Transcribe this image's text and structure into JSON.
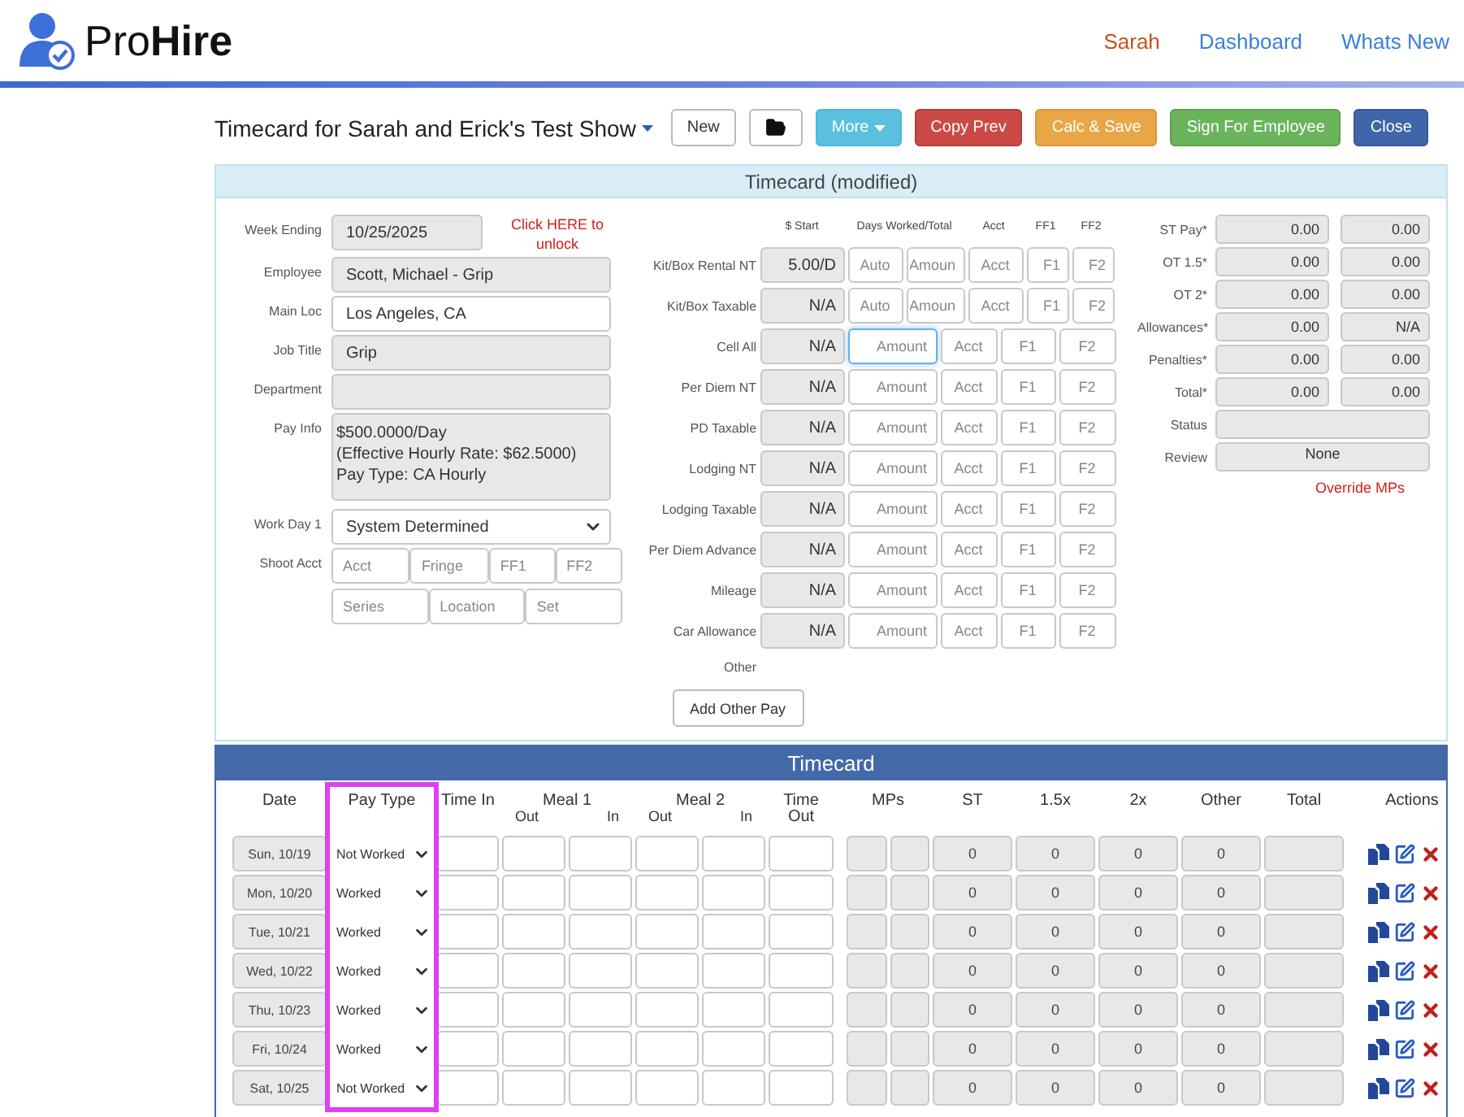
{
  "header": {
    "logo": "Pro**Hire**",
    "nav": [
      {
        "label": "Sarah",
        "kind": "user"
      },
      {
        "label": "Dashboard",
        "kind": "link"
      },
      {
        "label": "Whats New",
        "kind": "link"
      }
    ]
  },
  "toolbar": {
    "title": "Timecard for Sarah and Erick's Test Show",
    "buttons": [
      {
        "label": "New",
        "kind": "default",
        "dropdown": false
      },
      {
        "kind": "folder",
        "dropdown": false
      },
      {
        "label": "More",
        "kind": "info",
        "dropdown": true
      },
      {
        "label": "Copy Prev",
        "kind": "danger",
        "dropdown": false
      },
      {
        "label": "Calc & Save",
        "kind": "warning",
        "dropdown": false
      },
      {
        "label": "Sign For Employee",
        "kind": "success",
        "dropdown": false
      },
      {
        "label": "Close",
        "kind": "primary",
        "dropdown": false
      }
    ]
  },
  "details": {
    "title": "Timecard (modified)",
    "fields": [
      {
        "label": "Week Ending",
        "kind": "date",
        "value": "10/25/2025",
        "disabled": true,
        "link": "Click HERE to unlock"
      },
      {
        "label": "Employee",
        "kind": "text",
        "value": "Scott, Michael - Grip",
        "disabled": true
      },
      {
        "label": "Main Loc",
        "kind": "text",
        "value": "Los Angeles, CA",
        "disabled": false
      },
      {
        "label": "Job Title",
        "kind": "text",
        "value": "Grip",
        "disabled": true
      },
      {
        "label": "Department",
        "kind": "text",
        "disabled": true
      },
      {
        "label": "Pay Info",
        "kind": "multiline",
        "lines": [
          "$500.0000/Day",
          "(Effective Hourly Rate: $62.5000)",
          "Pay Type: CA Hourly"
        ],
        "disabled": true
      },
      {
        "label": "Work Day 1",
        "kind": "select",
        "value": "System Determined",
        "disabled": false
      },
      {
        "label": "Shoot Acct",
        "kind": "split",
        "placeholders": [
          [
            "Acct",
            "Fringe",
            "FF1",
            "FF2"
          ],
          [
            "Series",
            "Location",
            "Set"
          ]
        ],
        "disabled": false
      }
    ],
    "allowance_columns": [
      "$ Start",
      "Days Worked/Total",
      "Acct",
      "FF1",
      "FF2"
    ],
    "allowances": [
      {
        "label": "Kit/Box Rental NT",
        "rate": "5.00/D",
        "kind": "days",
        "focused": false,
        "placeholders": [
          "Auto",
          "Amoun",
          "Acct",
          "F1",
          "F2"
        ]
      },
      {
        "label": "Kit/Box Taxable",
        "rate": "N/A",
        "kind": "days",
        "focused": false,
        "placeholders": [
          "Auto",
          "Amoun",
          "Acct",
          "F1",
          "F2"
        ]
      },
      {
        "label": "Cell All",
        "rate": "N/A",
        "kind": "amount",
        "focused": true,
        "placeholders": [
          "Amount",
          "Acct",
          "F1",
          "F2"
        ]
      },
      {
        "label": "Per Diem NT",
        "rate": "N/A",
        "kind": "amount",
        "focused": false,
        "placeholders": [
          "Amount",
          "Acct",
          "F1",
          "F2"
        ]
      },
      {
        "label": "PD Taxable",
        "rate": "N/A",
        "kind": "amount",
        "focused": false,
        "placeholders": [
          "Amount",
          "Acct",
          "F1",
          "F2"
        ]
      },
      {
        "label": "Lodging NT",
        "rate": "N/A",
        "kind": "amount",
        "focused": false,
        "placeholders": [
          "Amount",
          "Acct",
          "F1",
          "F2"
        ]
      },
      {
        "label": "Lodging Taxable",
        "rate": "N/A",
        "kind": "amount",
        "focused": false,
        "placeholders": [
          "Amount",
          "Acct",
          "F1",
          "F2"
        ]
      },
      {
        "label": "Per Diem Advance",
        "rate": "N/A",
        "kind": "amount",
        "focused": false,
        "placeholders": [
          "Amount",
          "Acct",
          "F1",
          "F2"
        ]
      },
      {
        "label": "Mileage",
        "rate": "N/A",
        "kind": "amount",
        "focused": false,
        "placeholders": [
          "Amount",
          "Acct",
          "F1",
          "F2"
        ]
      },
      {
        "label": "Car Allowance",
        "rate": "N/A",
        "kind": "amount",
        "focused": false,
        "placeholders": [
          "Amount",
          "Acct",
          "F1",
          "F2"
        ]
      }
    ],
    "other_label": "Other",
    "add_other_button": "Add Other Pay",
    "totals": [
      {
        "label": "ST Pay*",
        "kind": "pair",
        "values": [
          "0.00",
          "0.00"
        ]
      },
      {
        "label": "OT 1.5*",
        "kind": "pair",
        "values": [
          "0.00",
          "0.00"
        ]
      },
      {
        "label": "OT 2*",
        "kind": "pair",
        "values": [
          "0.00",
          "0.00"
        ]
      },
      {
        "label": "Allowances*",
        "kind": "pair",
        "values": [
          "0.00",
          "N/A"
        ]
      },
      {
        "label": "Penalties*",
        "kind": "pair",
        "values": [
          "0.00",
          "0.00"
        ]
      },
      {
        "label": "Total*",
        "kind": "pair",
        "values": [
          "0.00",
          "0.00"
        ]
      },
      {
        "label": "Status",
        "kind": "wide"
      },
      {
        "label": "Review",
        "kind": "wide",
        "value": "None"
      }
    ],
    "override_link": "Override MPs"
  },
  "timecard": {
    "title": "Timecard",
    "columns": [
      {
        "label": "Date",
        "highlighted": false
      },
      {
        "label": "Pay Type",
        "highlighted": true
      },
      {
        "label": "Time In",
        "highlighted": false
      },
      {
        "label": "Meal 1",
        "sub": [
          "Out",
          "In"
        ],
        "highlighted": false
      },
      {
        "label": "Meal 2",
        "sub": [
          "Out",
          "In"
        ],
        "highlighted": false
      },
      {
        "label": "Time Out",
        "highlighted": false
      },
      {
        "label": "MPs",
        "highlighted": false
      },
      {
        "label": "ST",
        "highlighted": false
      },
      {
        "label": "1.5x",
        "highlighted": false
      },
      {
        "label": "2x",
        "highlighted": false
      },
      {
        "label": "Other",
        "highlighted": false
      },
      {
        "label": "Total",
        "highlighted": false
      },
      {
        "label": "Actions",
        "highlighted": false
      }
    ],
    "rows": [
      {
        "date": "Sun, 10/19",
        "pay_type": "Not Worked",
        "st": "0",
        "ot_15": "0",
        "ot_2": "0",
        "other": "0"
      },
      {
        "date": "Mon, 10/20",
        "pay_type": "Worked",
        "st": "0",
        "ot_15": "0",
        "ot_2": "0",
        "other": "0"
      },
      {
        "date": "Tue, 10/21",
        "pay_type": "Worked",
        "st": "0",
        "ot_15": "0",
        "ot_2": "0",
        "other": "0"
      },
      {
        "date": "Wed, 10/22",
        "pay_type": "Worked",
        "st": "0",
        "ot_15": "0",
        "ot_2": "0",
        "other": "0"
      },
      {
        "date": "Thu, 10/23",
        "pay_type": "Worked",
        "st": "0",
        "ot_15": "0",
        "ot_2": "0",
        "other": "0"
      },
      {
        "date": "Fri, 10/24",
        "pay_type": "Worked",
        "st": "0",
        "ot_15": "0",
        "ot_2": "0",
        "other": "0"
      },
      {
        "date": "Sat, 10/25",
        "pay_type": "Not Worked",
        "st": "0",
        "ot_15": "0",
        "ot_2": "0",
        "other": "0"
      }
    ]
  }
}
